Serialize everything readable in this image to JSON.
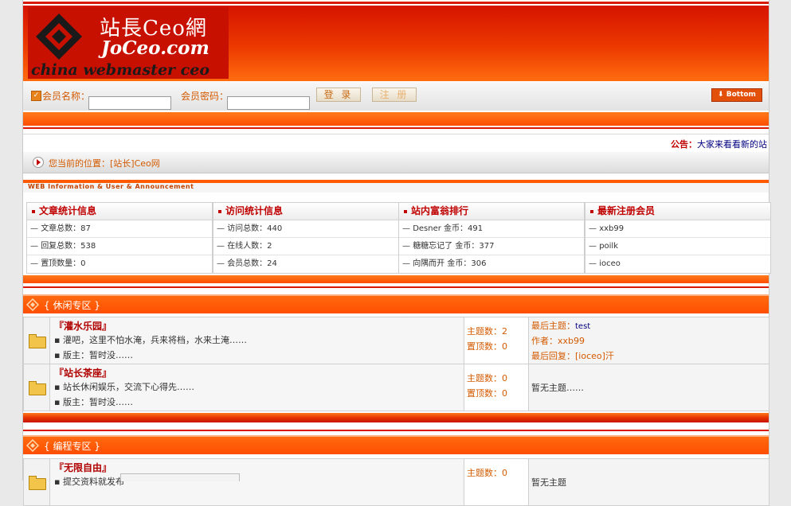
{
  "logo": {
    "cn": "站長Ceo網",
    "url": "JoCeo.com",
    "en": "china webmaster ceo"
  },
  "login": {
    "username_label": "会员名称：",
    "password_label": "会员密码：",
    "login_button": "登 录",
    "register_button": "注 册",
    "bottom_button": "⬇ Bottom"
  },
  "notice": {
    "label": "公告：",
    "text": "大家来看看新的站"
  },
  "location": {
    "text": "您当前的位置：[站长]Ceo网"
  },
  "stats_section": {
    "header": "WEB Information & User & Announcement",
    "panels": [
      {
        "title": "文章统计信息",
        "rows": [
          "文章总数：87",
          "回复总数：538",
          "置顶数量：0"
        ]
      },
      {
        "title": "访问统计信息",
        "rows": [
          "访问总数：440",
          "在线人数：2",
          "会员总数：24"
        ]
      },
      {
        "title": "站内富翁排行",
        "rows": [
          "Desner 金币：491",
          "糖糖忘记了 金币：377",
          "向隅而开 金币：306"
        ]
      },
      {
        "title": "最新注册会员",
        "rows": [
          "xxb99",
          "poilk",
          "ioceo"
        ]
      }
    ]
  },
  "categories": [
    {
      "title": "{ 休闲专区 }",
      "forums": [
        {
          "name": "『灌水乐园』",
          "desc": "灌吧，这里不怕水淹，兵来将档，水来土淹……",
          "moderator": "版主：暂时没……",
          "topics": "主题数：2",
          "pinned": "置顶数：0",
          "last_topic_label": "最后主题：",
          "last_topic": "test",
          "author_label": "作者：",
          "author": "xxb99",
          "last_reply_label": "最后回复：",
          "last_reply": "[ioceo]汗",
          "empty": ""
        },
        {
          "name": "『站长茶座』",
          "desc": "站长休闲娱乐，交流下心得先……",
          "moderator": "版主：暂时没……",
          "topics": "主题数：0",
          "pinned": "置顶数：0",
          "empty": "暂无主题……"
        }
      ]
    },
    {
      "title": "{ 编程专区 }",
      "forums": [
        {
          "name": "『无限自由』",
          "desc": "提交资料就发布",
          "topics": "主题数：0",
          "empty": "暂无主题"
        }
      ]
    }
  ]
}
